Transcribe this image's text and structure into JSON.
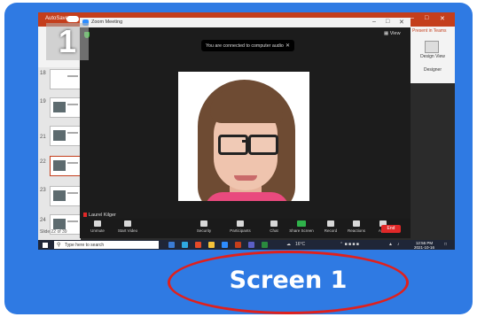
{
  "powerpoint": {
    "autosave_label": "AutoSave",
    "present_in_teams": "Present in Teams",
    "design_view_label": "Design View",
    "designer_label": "Designer",
    "slide_numbers": [
      "18",
      "19",
      "21",
      "22",
      "23",
      "24"
    ],
    "slide_counter": "Slide 22 of 39"
  },
  "zoom": {
    "title": "Zoom Meeting",
    "view_label": "View",
    "notice": "You are connected to computer audio",
    "participant_name": "Laurel Kilger",
    "toolbar": [
      {
        "label": "Unmute",
        "icon": "mic-icon"
      },
      {
        "label": "Start Video",
        "icon": "video-icon"
      },
      {
        "label": "Security",
        "icon": "shield-icon"
      },
      {
        "label": "Participants",
        "icon": "participants-icon"
      },
      {
        "label": "Chat",
        "icon": "chat-icon"
      },
      {
        "label": "Share Screen",
        "icon": "share-screen-icon"
      },
      {
        "label": "Record",
        "icon": "record-icon"
      },
      {
        "label": "Reactions",
        "icon": "reactions-icon"
      },
      {
        "label": "Apps",
        "icon": "apps-icon"
      }
    ],
    "end_label": "End"
  },
  "taskbar": {
    "search_placeholder": "Type here to search",
    "weather": "16°C",
    "time": "12:56 PM",
    "date": "2021-10-16"
  },
  "screen_badge": "1",
  "caption": "Screen 1",
  "colors": {
    "card_bg": "#2f7ae3",
    "ppt_accent": "#c43e1c",
    "end_button": "#e02828",
    "highlight_ellipse": "#e0201c"
  }
}
